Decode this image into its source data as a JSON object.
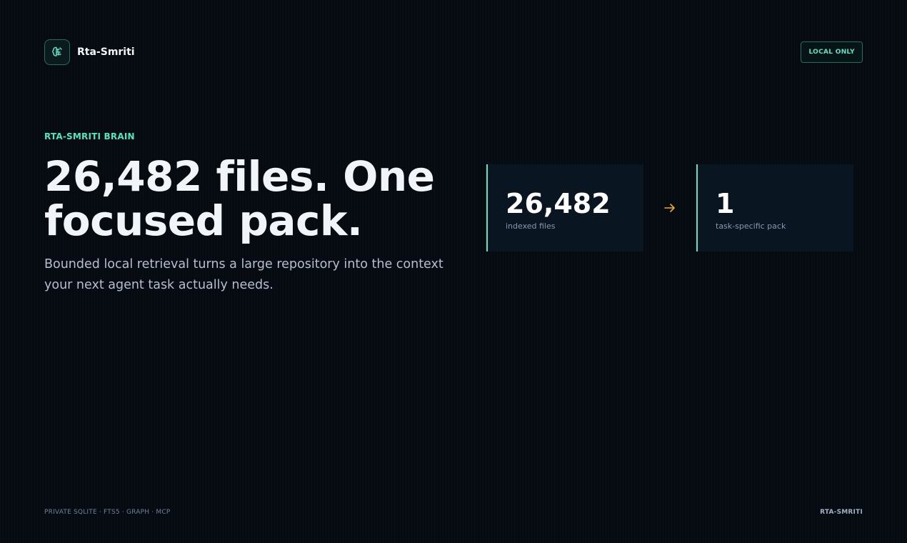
{
  "header": {
    "brand_name": "Rta-Smriti",
    "badge": "LOCAL ONLY"
  },
  "hero": {
    "eyebrow": "RTA-SMRITI BRAIN",
    "headline": "26,482 files. One focused pack.",
    "subtext": "Bounded local retrieval turns a large repository into the context your next agent task actually needs."
  },
  "stats": [
    {
      "value": "26,482",
      "label": "indexed files"
    },
    {
      "value": "1",
      "label": "task-specific pack"
    }
  ],
  "icons": {
    "logo": "brain-icon",
    "arrow": "arrow-right-icon"
  },
  "colors": {
    "accent": "#4de8c2",
    "arrow": "#f5a623",
    "background": "#060b12"
  },
  "footer": {
    "left": "PRIVATE SQLITE · FTS5 · GRAPH · MCP",
    "right": "RTA-SMRITI"
  }
}
